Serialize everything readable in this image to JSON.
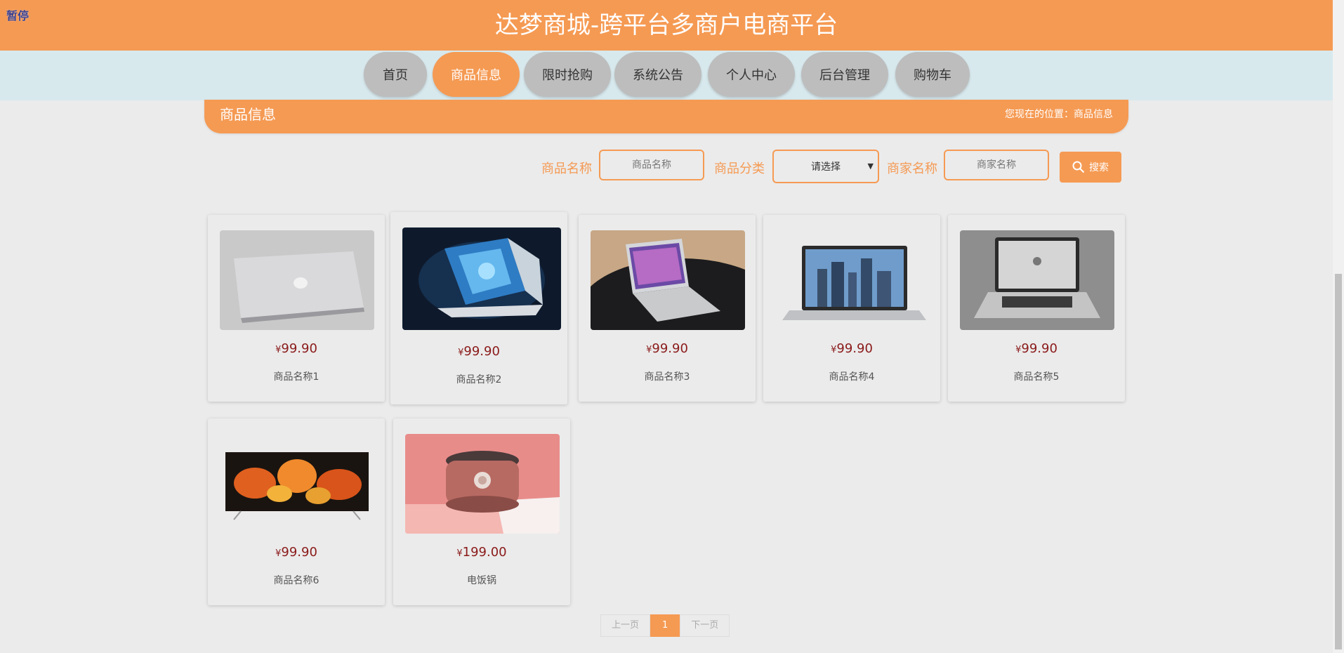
{
  "status": {
    "pause_label": "暂停"
  },
  "header": {
    "title": "达梦商城-跨平台多商户电商平台"
  },
  "nav": {
    "items": [
      {
        "label": "首页"
      },
      {
        "label": "商品信息"
      },
      {
        "label": "限时抢购"
      },
      {
        "label": "系统公告"
      },
      {
        "label": "个人中心"
      },
      {
        "label": "后台管理"
      },
      {
        "label": "购物车"
      }
    ],
    "active_index": 1
  },
  "breadcrumb": {
    "title": "商品信息",
    "location": "您现在的位置：商品信息"
  },
  "search": {
    "name_label": "商品名称",
    "name_placeholder": "商品名称",
    "category_label": "商品分类",
    "category_value": "请选择",
    "merchant_label": "商家名称",
    "merchant_placeholder": "商家名称",
    "button_label": "搜索"
  },
  "products": [
    {
      "currency": "¥",
      "price": "99.90",
      "name": "商品名称1",
      "image": "silver-laptop-closed"
    },
    {
      "currency": "¥",
      "price": "99.90",
      "name": "商品名称2",
      "image": "gaming-pc-case"
    },
    {
      "currency": "¥",
      "price": "99.90",
      "name": "商品名称3",
      "image": "laptop-on-table"
    },
    {
      "currency": "¥",
      "price": "99.90",
      "name": "商品名称4",
      "image": "laptop-city-screen"
    },
    {
      "currency": "¥",
      "price": "99.90",
      "name": "商品名称5",
      "image": "macbook-open"
    },
    {
      "currency": "¥",
      "price": "99.90",
      "name": "商品名称6",
      "image": "tv-flowers"
    },
    {
      "currency": "¥",
      "price": "199.00",
      "name": "电饭锅",
      "image": "rice-cooker"
    }
  ],
  "pagination": {
    "prev": "上一页",
    "current": "1",
    "next": "下一页"
  },
  "colors": {
    "accent": "#f59a53",
    "price": "#8b1a1a",
    "nav_bg": "#d8e9ee",
    "page_bg": "#ebebeb"
  }
}
